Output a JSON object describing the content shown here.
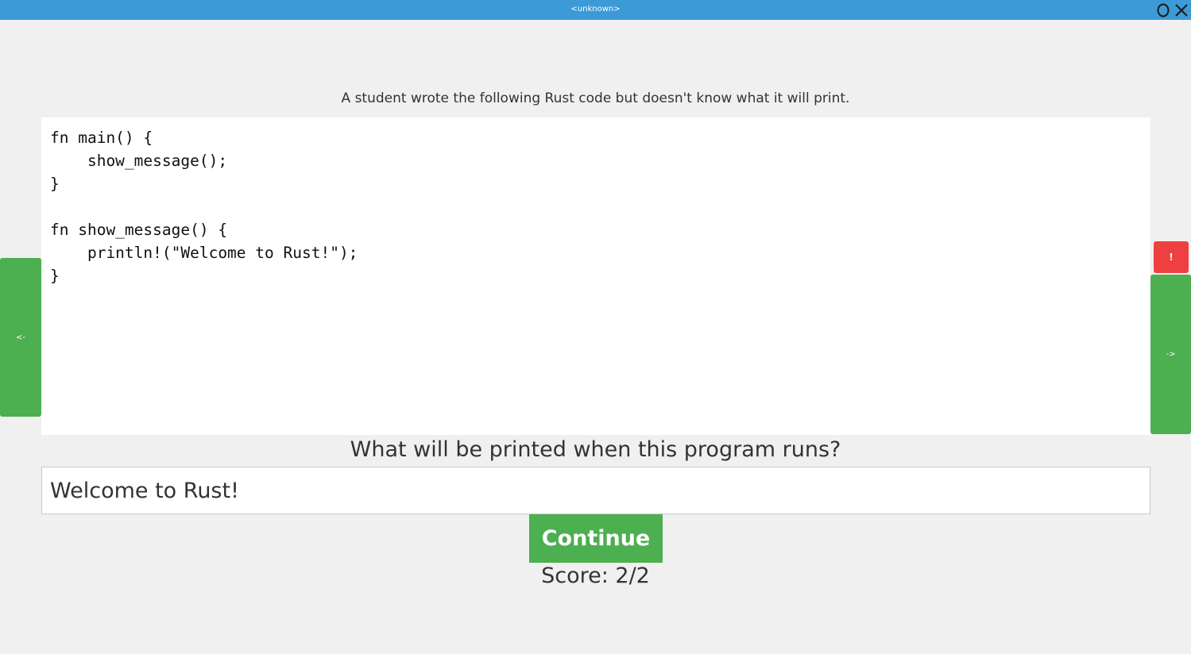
{
  "window": {
    "title": "<unknown>",
    "maximize_icon": "maximize-icon",
    "close_icon": "close-icon"
  },
  "prompt": "A student wrote the following Rust code but doesn't know what it will print.",
  "code": "fn main() {\n    show_message();\n}\n\nfn show_message() {\n    println!(\"Welcome to Rust!\");\n}",
  "question": "What will be printed when this program runs?",
  "answer": {
    "value": "Welcome to Rust!",
    "placeholder": ""
  },
  "continue_label": "Continue",
  "score": "Score: 2/2",
  "nav": {
    "prev_label": "<-",
    "next_label": "->",
    "report_label": "!"
  },
  "colors": {
    "titlebar": "#3c9ad6",
    "background": "#f0f0f0",
    "accent_green": "#4caf50",
    "report_red": "#ee4040"
  }
}
